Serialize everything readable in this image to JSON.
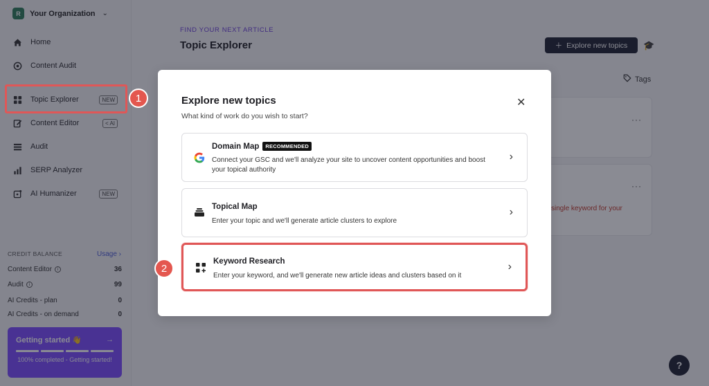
{
  "org": {
    "avatar": "R",
    "name": "Your Organization"
  },
  "sidebar": {
    "items": [
      {
        "label": "Home",
        "icon": "home-icon"
      },
      {
        "label": "Content Audit",
        "icon": "content-audit-icon"
      },
      {
        "label": "Topic Explorer",
        "icon": "grid-icon",
        "badge": "NEW"
      },
      {
        "label": "Content Editor",
        "icon": "edit-icon",
        "badge": "AI"
      },
      {
        "label": "Audit",
        "icon": "list-icon"
      },
      {
        "label": "SERP Analyzer",
        "icon": "bar-chart-icon"
      },
      {
        "label": "AI Humanizer",
        "icon": "humanizer-icon",
        "badge": "NEW"
      }
    ]
  },
  "credits": {
    "heading": "CREDIT BALANCE",
    "usage_link": "Usage",
    "rows": [
      {
        "label": "Content Editor",
        "value": "36"
      },
      {
        "label": "Audit",
        "value": "99"
      },
      {
        "label": "AI Credits - plan",
        "value": "0"
      },
      {
        "label": "AI Credits - on demand",
        "value": "0"
      }
    ]
  },
  "getting_started": {
    "title": "Getting started 👋",
    "subtitle": "100% completed - Getting started!",
    "progress": 1.0
  },
  "main": {
    "eyebrow": "FIND YOUR NEXT ARTICLE",
    "title": "Topic Explorer",
    "explore_button": "Explore new topics",
    "tags_label": "Tags",
    "background_text": "single keyword for your"
  },
  "modal": {
    "title": "Explore new topics",
    "subtitle": "What kind of work do you wish to start?",
    "options": [
      {
        "title": "Domain Map",
        "badge": "RECOMMENDED",
        "description": "Connect your GSC and we'll analyze your site to uncover content opportunities and boost your topical authority",
        "icon": "google-icon"
      },
      {
        "title": "Topical Map",
        "description": "Enter your topic and we'll generate article clusters to explore",
        "icon": "layers-icon"
      },
      {
        "title": "Keyword Research",
        "description": "Enter your keyword, and we'll generate new article ideas and clusters based on it",
        "icon": "grid-plus-icon"
      }
    ]
  },
  "annotations": {
    "step1": "1",
    "step2": "2"
  },
  "colors": {
    "accent": "#7c4dff",
    "highlight": "#e05757",
    "dark_button": "#1f2233"
  }
}
